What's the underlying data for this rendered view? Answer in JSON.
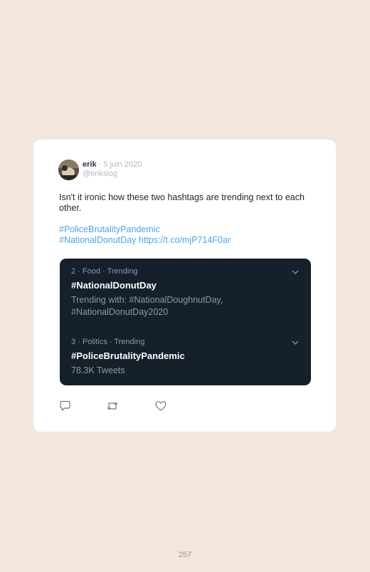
{
  "tweet": {
    "author_name": "erik",
    "separator": " · ",
    "date": "5 juin 2020",
    "handle": "@erikslog",
    "text": "Isn't it ironic how these two hashtags are trending next to each other.",
    "hashtag_1": "#PoliceBrutalityPandemic",
    "hashtag_2": "#NationalDonutDay",
    "link": "https://t.co/mjP714F0ar"
  },
  "embed": {
    "trends": [
      {
        "meta": "2 · Food · Trending",
        "title": "#NationalDonutDay",
        "subtitle": "Trending with: #NationalDoughnutDay, #NationalDonutDay2020",
        "icon": "chevron-down-icon"
      },
      {
        "meta": "3 · Politics · Trending",
        "title": "#PoliceBrutalityPandemic",
        "subtitle": "78.3K Tweets",
        "icon": "chevron-down-icon"
      }
    ]
  },
  "actions": {
    "reply_icon": "reply-icon",
    "retweet_icon": "retweet-icon",
    "like_icon": "heart-icon"
  },
  "page": {
    "number": "257"
  },
  "colors": {
    "page_background": "#f3e7dd",
    "card_background": "#ffffff",
    "link_blue": "#4aa5e6",
    "embed_background": "#15202b"
  }
}
